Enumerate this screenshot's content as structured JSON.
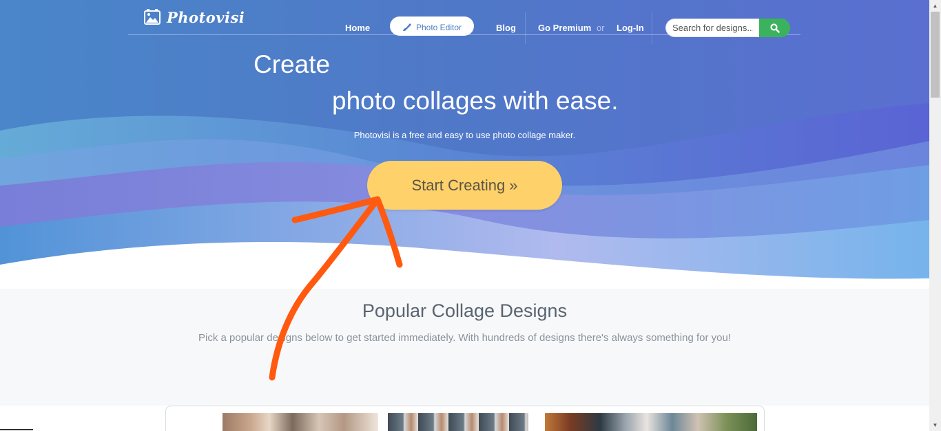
{
  "brand": {
    "name": "Photovisi"
  },
  "nav": {
    "home": "Home",
    "photo_editor": "Photo Editor",
    "blog": "Blog",
    "premium": "Go Premium",
    "or": "or",
    "login": "Log-In"
  },
  "search": {
    "placeholder": "Search for designs..."
  },
  "hero": {
    "line1": "Create",
    "line2": "photo collages with ease.",
    "subtitle": "Photovisi is a free and easy to use photo collage maker.",
    "cta": "Start Creating »"
  },
  "popular": {
    "title": "Popular Collage Designs",
    "subtitle": "Pick a popular designs below to get started immediately. With hundreds of designs there's always something for you!"
  },
  "icons": {
    "logo": "photo-frame-icon",
    "editor": "brush-icon",
    "search": "magnifier-icon",
    "annotation": "arrow-annotation"
  },
  "colors": {
    "hero_blue": "#4f86c6",
    "hero_purple": "#6a5ed0",
    "cta_yellow": "#ffd16b",
    "search_green": "#3bb35c",
    "annotation_orange": "#ff5a0f"
  }
}
